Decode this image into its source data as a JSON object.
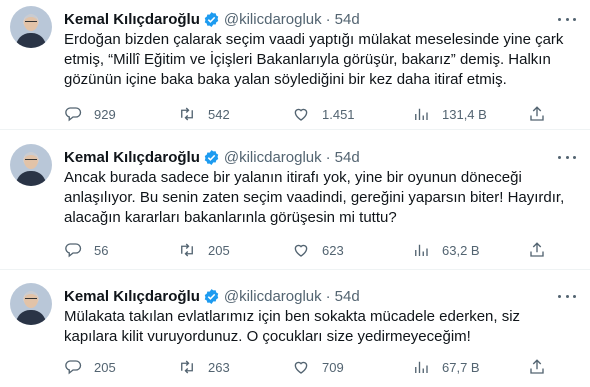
{
  "tweets": [
    {
      "name": "Kemal Kılıçdaroğlu",
      "handle": "@kilicdarogluk",
      "separator": "·",
      "time": "54d",
      "text": "Erdoğan bizden çalarak seçim vaadi yaptığı mülakat meselesinde yine çark\netmiş, “Millî Eğitim ve İçişleri Bakanlarıyla görüşür, bakarız” demiş. Halkın\ngözünün içine baka baka yalan söylediğini bir kez daha itiraf etmiş.",
      "replies": "929",
      "retweets": "542",
      "likes": "1.451",
      "views": "131,4 B"
    },
    {
      "name": "Kemal Kılıçdaroğlu",
      "handle": "@kilicdarogluk",
      "separator": "·",
      "time": "54d",
      "text": "Ancak burada sadece bir yalanın itirafı yok, yine bir oyunun döneceği\nanlaşılıyor. Bu senin zaten seçim vaadindi, gereğini yaparsın biter! Hayırdır,\nalacağın kararları bakanlarınla görüşesin mi tuttu?",
      "replies": "56",
      "retweets": "205",
      "likes": "623",
      "views": "63,2 B"
    },
    {
      "name": "Kemal Kılıçdaroğlu",
      "handle": "@kilicdarogluk",
      "separator": "·",
      "time": "54d",
      "text": "Mülakata takılan evlatlarımız için ben sokakta mücadele ederken, siz\nkapılara kilit vuruyordunuz. O çocukları size yedirmeyeceğim!",
      "replies": "205",
      "retweets": "263",
      "likes": "709",
      "views": "67,7 B"
    }
  ],
  "icons": {
    "verified": "verified-badge-icon",
    "reply": "reply-icon",
    "retweet": "retweet-icon",
    "like": "heart-icon",
    "views": "views-bar-chart-icon",
    "share": "share-icon",
    "more": "more-dots-icon"
  },
  "colors": {
    "text": "#0f1419",
    "muted": "#536471",
    "verified": "#1d9bf0",
    "divider": "#eff3f4"
  }
}
